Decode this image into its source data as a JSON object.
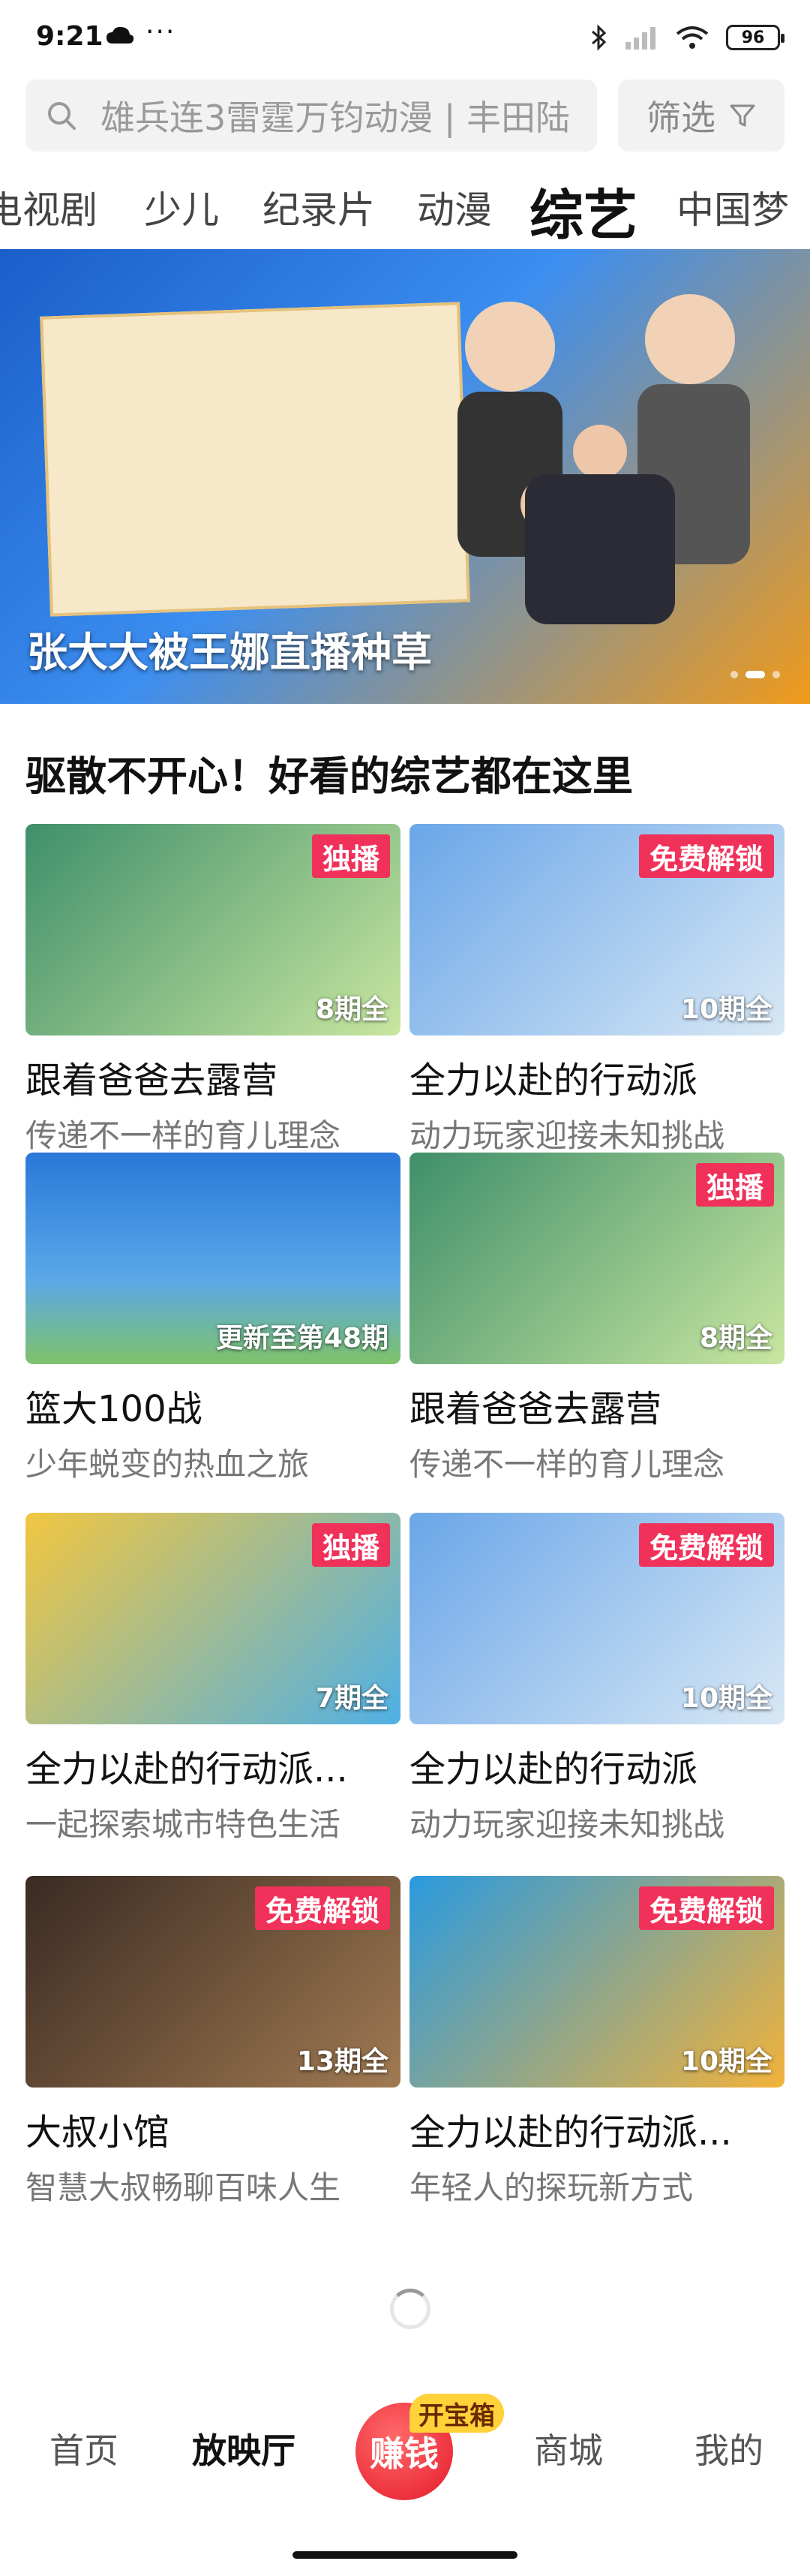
{
  "status_bar": {
    "time": "9:21",
    "dots": "···",
    "battery": "96"
  },
  "search": {
    "placeholder": "雄兵连3雷霆万钧动漫 | 丰田陆",
    "filter_label": "筛选"
  },
  "tabs": [
    {
      "label": "电视剧"
    },
    {
      "label": "少儿"
    },
    {
      "label": "纪录片"
    },
    {
      "label": "动漫"
    },
    {
      "label": "综艺",
      "active": true
    },
    {
      "label": "中国梦"
    }
  ],
  "banner": {
    "title": "张大大被王娜直播种草"
  },
  "section": {
    "title": "驱散不开心！好看的综艺都在这里",
    "cards": [
      {
        "title": "跟着爸爸去露营",
        "subtitle": "传递不一样的育儿理念",
        "badge": "独播",
        "episodes": "8期全",
        "color1": "#3f8f6a",
        "color2": "#c8e6a0"
      },
      {
        "title": "全力以赴的行动派",
        "subtitle": "动力玩家迎接未知挑战",
        "badge": "免费解锁",
        "episodes": "10期全",
        "color1": "#6aa6e8",
        "color2": "#d8e8f5"
      },
      {
        "title": "篮大100战",
        "subtitle": "少年蜕变的热血之旅",
        "badge": "",
        "episodes": "更新至第48期",
        "color1": "#2a78d8",
        "color2": "#7fc26a"
      },
      {
        "title": "跟着爸爸去露营",
        "subtitle": "传递不一样的育儿理念",
        "badge": "独播",
        "episodes": "8期全",
        "color1": "#3f8f6a",
        "color2": "#c8e6a0"
      },
      {
        "title": "全力以赴的行动派...",
        "subtitle": "一起探索城市特色生活",
        "badge": "独播",
        "episodes": "7期全",
        "color1": "#f2c640",
        "color2": "#4fb0e6"
      },
      {
        "title": "全力以赴的行动派",
        "subtitle": "动力玩家迎接未知挑战",
        "badge": "免费解锁",
        "episodes": "10期全",
        "color1": "#6aa6e8",
        "color2": "#d8e8f5"
      },
      {
        "title": "大叔小馆",
        "subtitle": "智慧大叔畅聊百味人生",
        "badge": "免费解锁",
        "episodes": "13期全",
        "color1": "#3a2a22",
        "color2": "#a07a52"
      },
      {
        "title": "全力以赴的行动派...",
        "subtitle": "年轻人的探玩新方式",
        "badge": "免费解锁",
        "episodes": "10期全",
        "color1": "#2a9adf",
        "color2": "#f2b23a"
      }
    ]
  },
  "bottom_nav": {
    "home": "首页",
    "cinema": "放映厅",
    "earn": "赚钱",
    "chest": "开宝箱",
    "mall": "商城",
    "me": "我的"
  },
  "colors": {
    "accent": "#f0315a",
    "earn": "#e51a2b"
  }
}
